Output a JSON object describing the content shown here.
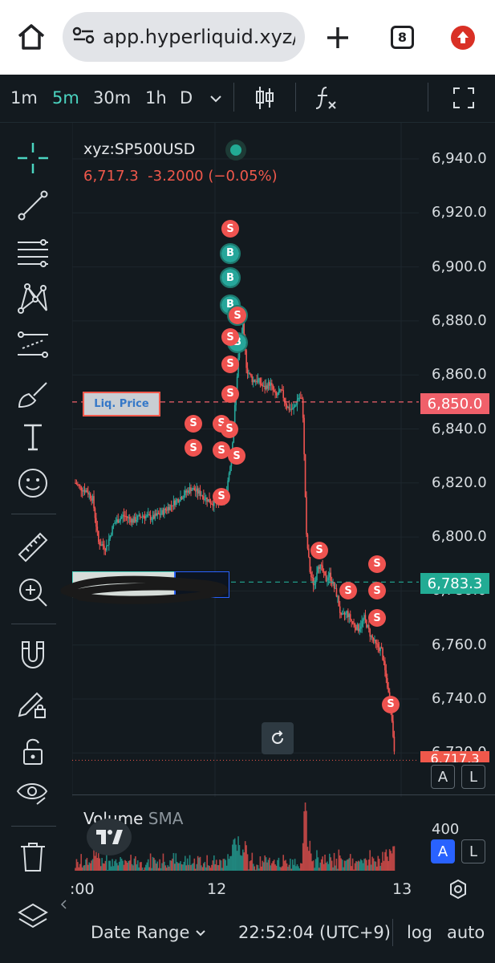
{
  "browser": {
    "url": "app.hyperliquid.xyz/",
    "tab_count": "8",
    "icons": [
      "home-icon",
      "site-settings-icon",
      "new-tab-icon",
      "tab-switcher-icon",
      "update-icon"
    ]
  },
  "timeframes": {
    "items": [
      "1m",
      "5m",
      "30m",
      "1h",
      "D"
    ],
    "active": "5m"
  },
  "chart": {
    "symbol": "xyz:SP500USD",
    "ohlc": "6,717.3  -3.2000 (−0.05%)",
    "liq_label": "Liq. Price",
    "liq_price": "6,850.0",
    "current_price": "6,783.3",
    "last_price_tag": "6,717.3",
    "y_labels": [
      "6,940.0",
      "6,920.0",
      "6,900.0",
      "6,880.0",
      "6,860.0",
      "6,840.0",
      "6,820.0",
      "6,800.0",
      "6,780.0",
      "6,760.0",
      "6,740.0",
      "6,720.0"
    ],
    "x_labels": [
      ":00",
      "12",
      "13"
    ],
    "colors": {
      "up": "#26a69a",
      "down": "#ef5350",
      "background": "#131a1f",
      "accent": "#4bd4c0"
    },
    "marker_b": "B",
    "marker_s": "S"
  },
  "volume": {
    "title": "Volume",
    "sma": "SMA",
    "label": "400"
  },
  "axis_buttons": {
    "a": "A",
    "l": "L"
  },
  "bottom": {
    "date_range": "Date Range",
    "clock": "22:52:04 (UTC+9)",
    "log": "log",
    "auto": "auto"
  },
  "chart_data": {
    "type": "candlestick",
    "title": "xyz:SP500USD",
    "x": [
      "11 ~19:00",
      "12",
      "13"
    ],
    "ylim": [
      6710,
      6950
    ],
    "close_path": [
      [
        0,
        6820
      ],
      [
        3,
        6818
      ],
      [
        6,
        6817
      ],
      [
        9,
        6814
      ],
      [
        12,
        6798
      ],
      [
        16,
        6796
      ],
      [
        20,
        6805
      ],
      [
        25,
        6808
      ],
      [
        30,
        6806
      ],
      [
        35,
        6808
      ],
      [
        40,
        6807
      ],
      [
        45,
        6809
      ],
      [
        50,
        6812
      ],
      [
        55,
        6815
      ],
      [
        60,
        6818
      ],
      [
        65,
        6816
      ],
      [
        70,
        6813
      ],
      [
        74,
        6812
      ],
      [
        78,
        6815
      ],
      [
        81,
        6830
      ],
      [
        83,
        6850
      ],
      [
        85,
        6870
      ],
      [
        87,
        6878
      ],
      [
        89,
        6862
      ],
      [
        92,
        6858
      ],
      [
        95,
        6858
      ],
      [
        98,
        6855
      ],
      [
        101,
        6857
      ],
      [
        104,
        6852
      ],
      [
        107,
        6854
      ],
      [
        110,
        6848
      ],
      [
        113,
        6847
      ],
      [
        116,
        6852
      ],
      [
        118,
        6850
      ],
      [
        120,
        6800
      ],
      [
        122,
        6786
      ],
      [
        124,
        6782
      ],
      [
        126,
        6790
      ],
      [
        128,
        6788
      ],
      [
        130,
        6784
      ],
      [
        132,
        6786
      ],
      [
        134,
        6782
      ],
      [
        136,
        6778
      ],
      [
        138,
        6770
      ],
      [
        141,
        6772
      ],
      [
        144,
        6768
      ],
      [
        147,
        6766
      ],
      [
        150,
        6770
      ],
      [
        153,
        6764
      ],
      [
        156,
        6760
      ],
      [
        159,
        6758
      ],
      [
        162,
        6745
      ],
      [
        164,
        6735
      ],
      [
        166,
        6718
      ]
    ],
    "buy_markers": [
      6905,
      6896,
      6886,
      6882,
      6872
    ],
    "sell_markers": [
      6914,
      6882,
      6874,
      6864,
      6853,
      6842,
      6840,
      6833,
      6832,
      6830,
      6815,
      6795,
      6784,
      6790,
      6780,
      6780,
      6778,
      6770,
      6738
    ],
    "horizontal_lines": [
      {
        "label": "Liq. Price",
        "value": 6850.0
      },
      {
        "value": 6783.3
      }
    ]
  }
}
